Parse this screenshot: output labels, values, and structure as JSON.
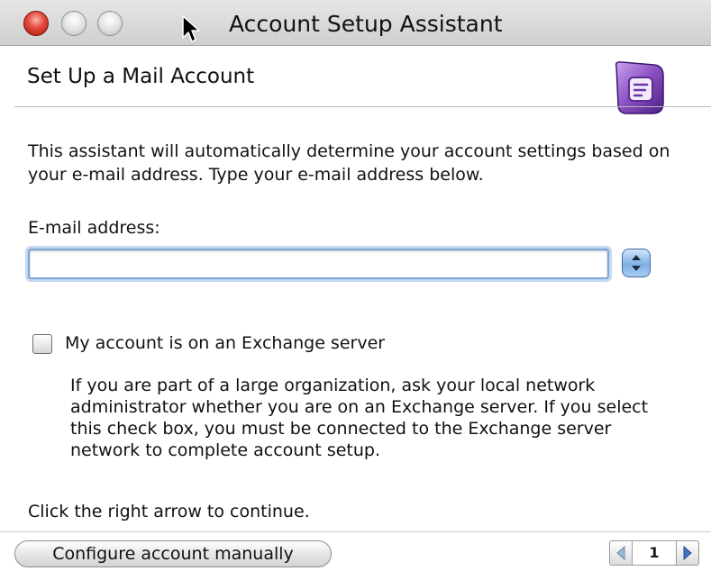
{
  "window": {
    "title": "Account Setup Assistant"
  },
  "header": {
    "title": "Set Up a Mail Account",
    "logo_icon": "outlook-entourage-icon"
  },
  "intro": {
    "text": "This assistant will automatically determine your account settings based on your e-mail address. Type your e-mail address below."
  },
  "email": {
    "label": "E-mail address:",
    "value": "",
    "placeholder": ""
  },
  "exchange": {
    "checkbox_label": "My account is on an Exchange server",
    "checked": false,
    "note_lines": [
      "If you are part of a large organization, ask your local network",
      "administrator whether you are on an Exchange server. If you select",
      "this check box, you must be connected to the Exchange server",
      "network to complete account setup."
    ]
  },
  "footer": {
    "continue_text": "Click the right arrow to continue.",
    "manual_button": "Configure account manually",
    "page_number": "1"
  },
  "colors": {
    "close_button": "#e2473a",
    "focus_ring": "#7aa7d6",
    "stepper": "#7fb0e6",
    "logo_purple": "#8a4fc0"
  }
}
